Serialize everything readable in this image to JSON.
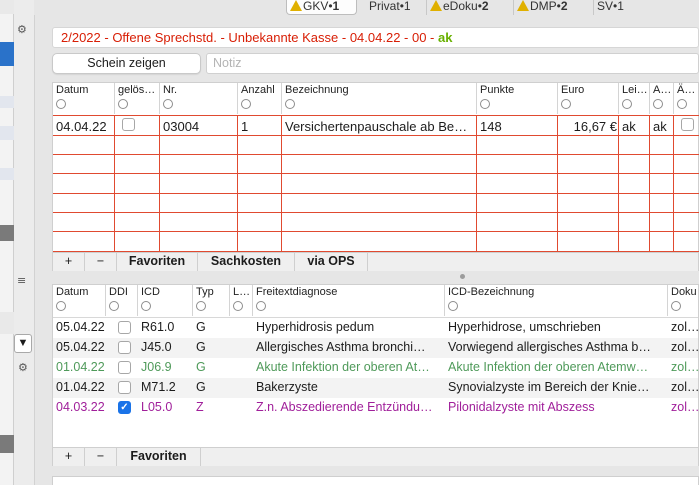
{
  "tabs": [
    {
      "label": "GKV",
      "count": "1",
      "warning": true,
      "active": true
    },
    {
      "label": "Privat",
      "count": "1",
      "warning": false,
      "active": false
    },
    {
      "label": "eDoku",
      "count": "2",
      "warning": true,
      "active": false
    },
    {
      "label": "DMP",
      "count": "2",
      "warning": true,
      "active": false
    },
    {
      "label": "SV",
      "count": "1",
      "warning": false,
      "active": false
    }
  ],
  "case_title": {
    "text": "2/2022 - Offene Sprechstd. - Unbekannte Kasse - 04.04.22 - 00 - ",
    "status": "ak"
  },
  "toolbar": {
    "schein_label": "Schein zeigen",
    "notiz_placeholder": "Notiz"
  },
  "services": {
    "columns": [
      "Datum",
      "gelös…",
      "Nr.",
      "Anzahl",
      "Bezeichnung",
      "Punkte",
      "Euro",
      "Lei…",
      "A…",
      "Ä…"
    ],
    "rows": [
      {
        "datum": "04.04.22",
        "geloescht": false,
        "nr": "03004",
        "anzahl": "1",
        "bezeichnung": "Versichertenpauschale ab Be…",
        "punkte": "148",
        "euro": "16,67 €",
        "lei": "ak",
        "a": "ak",
        "ae": ""
      }
    ],
    "buttons": {
      "add": "+",
      "remove": "−",
      "favoriten": "Favoriten",
      "sachkosten": "Sachkosten",
      "via_ops": "via OPS"
    }
  },
  "diagnoses": {
    "columns": [
      "Datum",
      "DDI",
      "ICD",
      "Typ",
      "L…",
      "Freitextdiagnose",
      "ICD-Bezeichnung",
      "Doku"
    ],
    "rows": [
      {
        "datum": "05.04.22",
        "ddi": false,
        "icd": "R61.0",
        "typ": "G",
        "l": "",
        "freitext": "Hyperhidrosis pedum",
        "bezeichnung": "Hyperhidrose, umschrieben",
        "doku": "zol…",
        "style": "normal"
      },
      {
        "datum": "05.04.22",
        "ddi": false,
        "icd": "J45.0",
        "typ": "G",
        "l": "",
        "freitext": "Allergisches Asthma bronchi…",
        "bezeichnung": "Vorwiegend allergisches Asthma b…",
        "doku": "zol…",
        "style": "normal"
      },
      {
        "datum": "01.04.22",
        "ddi": false,
        "icd": "J06.9",
        "typ": "G",
        "l": "",
        "freitext": "Akute Infektion der oberen At…",
        "bezeichnung": "Akute Infektion der oberen Atemw…",
        "doku": "zol…",
        "style": "green"
      },
      {
        "datum": "01.04.22",
        "ddi": false,
        "icd": "M71.2",
        "typ": "G",
        "l": "",
        "freitext": "Bakerzyste",
        "bezeichnung": "Synovialzyste im Bereich der Knie…",
        "doku": "zol…",
        "style": "normal"
      },
      {
        "datum": "04.03.22",
        "ddi": true,
        "icd": "L05.0",
        "typ": "Z",
        "l": "",
        "freitext": "Z.n. Abszedierende Entzündu…",
        "bezeichnung": "Pilonidalzyste mit Abszess",
        "doku": "zol…",
        "style": "purple"
      }
    ],
    "buttons": {
      "add": "+",
      "remove": "−",
      "favoriten": "Favoriten"
    }
  },
  "colors": {
    "title_red": "#d81e05",
    "status_green": "#68b000",
    "grid_red": "#e04a30",
    "row_green": "#4f9a5a",
    "row_purple": "#a01f9a",
    "checkbox_blue": "#1a73e8"
  },
  "icons": [
    "warning-triangle-icon",
    "gear-icon",
    "filter-icon",
    "list-icon",
    "checkmark-icon"
  ]
}
